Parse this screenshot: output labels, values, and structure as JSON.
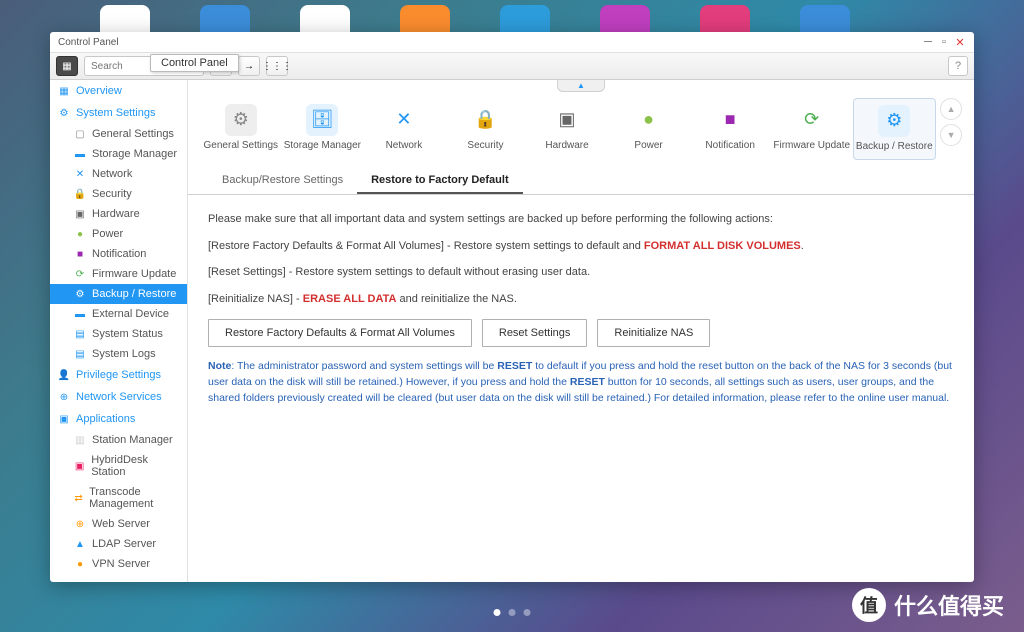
{
  "window": {
    "title": "Control Panel",
    "tooltip": "Control Panel"
  },
  "toolbar": {
    "search_placeholder": "Search"
  },
  "sidebar": {
    "groups": [
      {
        "label": "Overview",
        "items": []
      },
      {
        "label": "System Settings",
        "items": [
          {
            "label": "General Settings"
          },
          {
            "label": "Storage Manager"
          },
          {
            "label": "Network"
          },
          {
            "label": "Security"
          },
          {
            "label": "Hardware"
          },
          {
            "label": "Power"
          },
          {
            "label": "Notification"
          },
          {
            "label": "Firmware Update"
          },
          {
            "label": "Backup / Restore",
            "active": true
          },
          {
            "label": "External Device"
          },
          {
            "label": "System Status"
          },
          {
            "label": "System Logs"
          }
        ]
      },
      {
        "label": "Privilege Settings",
        "items": []
      },
      {
        "label": "Network Services",
        "items": []
      },
      {
        "label": "Applications",
        "items": [
          {
            "label": "Station Manager"
          },
          {
            "label": "HybridDesk Station"
          },
          {
            "label": "Transcode Management"
          },
          {
            "label": "Web Server"
          },
          {
            "label": "LDAP Server"
          },
          {
            "label": "VPN Server"
          }
        ]
      }
    ]
  },
  "categories": [
    {
      "label": "General Settings",
      "icon": "⚙",
      "bg": "#eee",
      "fg": "#888"
    },
    {
      "label": "Storage Manager",
      "icon": "🗄",
      "bg": "#e3f2fd",
      "fg": "#2196f3"
    },
    {
      "label": "Network",
      "icon": "✕",
      "bg": "#fff",
      "fg": "#2196f3"
    },
    {
      "label": "Security",
      "icon": "🔒",
      "bg": "#fff",
      "fg": "#999"
    },
    {
      "label": "Hardware",
      "icon": "▣",
      "bg": "#fff",
      "fg": "#666"
    },
    {
      "label": "Power",
      "icon": "●",
      "bg": "#fff",
      "fg": "#8bc34a"
    },
    {
      "label": "Notification",
      "icon": "■",
      "bg": "#fff",
      "fg": "#9c27b0"
    },
    {
      "label": "Firmware Update",
      "icon": "⟳",
      "bg": "#fff",
      "fg": "#4caf50"
    },
    {
      "label": "Backup / Restore",
      "icon": "⚙",
      "bg": "#e3f2fd",
      "fg": "#2196f3",
      "active": true
    }
  ],
  "tabs": [
    {
      "label": "Backup/Restore Settings"
    },
    {
      "label": "Restore to Factory Default",
      "active": true
    }
  ],
  "content": {
    "intro": "Please make sure that all important data and system settings are backed up before performing the following actions:",
    "line1_a": "[Restore Factory Defaults & Format All Volumes] - Restore system settings to default and ",
    "line1_b": "FORMAT ALL DISK VOLUMES",
    "line1_c": ".",
    "line2": "[Reset Settings] - Restore system settings to default without erasing user data.",
    "line3_a": "[Reinitialize NAS] - ",
    "line3_b": "ERASE ALL DATA",
    "line3_c": " and reinitialize the NAS.",
    "btn1": "Restore Factory Defaults & Format All Volumes",
    "btn2": "Reset Settings",
    "btn3": "Reinitialize NAS",
    "note_label": "Note",
    "note_a": ": The administrator password and system settings will be ",
    "note_b": "RESET",
    "note_c": " to default if you press and hold the reset button on the back of the NAS for 3 seconds (but user data on the disk will still be retained.) However, if you press and hold the ",
    "note_d": "RESET",
    "note_e": " button for 10 seconds, all settings such as users, user groups, and the shared folders previously created will be cleared (but user data on the disk will still be retained.) For detailed information, please refer to the online user manual."
  },
  "watermark": "什么值得买"
}
